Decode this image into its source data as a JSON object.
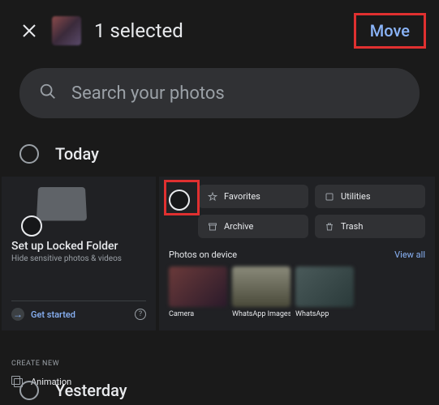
{
  "header": {
    "title": "1 selected",
    "action": "Move"
  },
  "search": {
    "placeholder": "Search your photos"
  },
  "sections": {
    "today": "Today",
    "yesterday": "Yesterday"
  },
  "locked_folder": {
    "title": "Set up Locked Folder",
    "subtitle": "Hide sensitive photos & videos",
    "cta": "Get started"
  },
  "create": {
    "label": "CREATE NEW",
    "animation": "Animation"
  },
  "library": {
    "chips": {
      "favorites": "Favorites",
      "utilities": "Utilities",
      "archive": "Archive",
      "trash": "Trash"
    },
    "device_header": "Photos on device",
    "view_all": "View all",
    "folders": [
      "Camera",
      "WhatsApp Images",
      "WhatsApp"
    ]
  }
}
